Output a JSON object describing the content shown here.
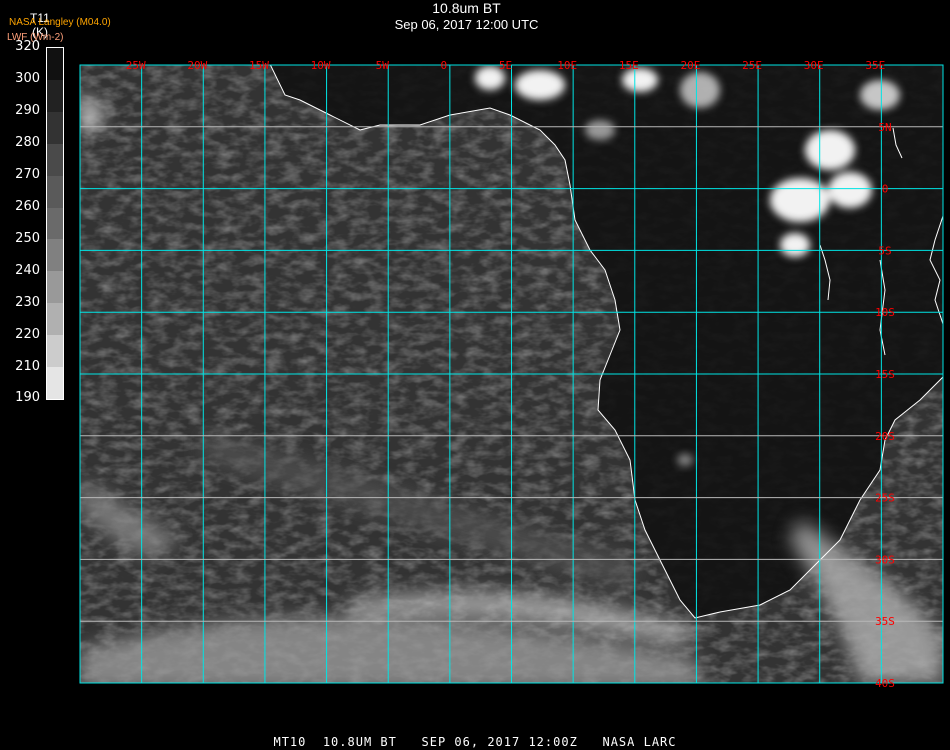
{
  "header": {
    "title": "10.8um BT",
    "subtitle": "Sep 06, 2017 12:00 UTC"
  },
  "colorbar": {
    "variable": "T11",
    "unit": "(K)",
    "org_label": "NASA Langley (M04.0)",
    "product_label": "LWF (Wm-2)",
    "labels": [
      "320",
      "300",
      "290",
      "280",
      "270",
      "260",
      "250",
      "240",
      "230",
      "220",
      "210",
      "190"
    ],
    "segment_colors": [
      "#111111",
      "#222222",
      "#333333",
      "#4a4a4a",
      "#5a5a5a",
      "#6a6a6a",
      "#808080",
      "#999999",
      "#b0b0b0",
      "#cccccc",
      "#e5e5e5",
      "#ffffff"
    ]
  },
  "map": {
    "lon_range": [
      -30,
      40
    ],
    "lat_range": [
      -40,
      10
    ],
    "grid_color": "#00e5e5",
    "label_color": "#ff0000",
    "coast_color": "#ffffff",
    "lon_labels": [
      {
        "lon": -25,
        "text": "25W"
      },
      {
        "lon": -20,
        "text": "20W"
      },
      {
        "lon": -15,
        "text": "15W"
      },
      {
        "lon": -10,
        "text": "10W"
      },
      {
        "lon": -5,
        "text": "5W"
      },
      {
        "lon": 0,
        "text": "0"
      },
      {
        "lon": 5,
        "text": "5E"
      },
      {
        "lon": 10,
        "text": "10E"
      },
      {
        "lon": 15,
        "text": "15E"
      },
      {
        "lon": 20,
        "text": "20E"
      },
      {
        "lon": 25,
        "text": "25E"
      },
      {
        "lon": 30,
        "text": "30E"
      },
      {
        "lon": 35,
        "text": "35E"
      }
    ],
    "lat_labels": [
      {
        "lat": 5,
        "text": "5N"
      },
      {
        "lat": 0,
        "text": "0"
      },
      {
        "lat": -5,
        "text": "5S"
      },
      {
        "lat": -10,
        "text": "10S"
      },
      {
        "lat": -15,
        "text": "15S"
      },
      {
        "lat": -20,
        "text": "20S"
      },
      {
        "lat": -25,
        "text": "25S"
      },
      {
        "lat": -30,
        "text": "30S"
      },
      {
        "lat": -35,
        "text": "35S"
      },
      {
        "lat": -40,
        "text": "40S"
      }
    ]
  },
  "footer": {
    "text": "MT10  10.8UM BT   SEP 06, 2017 12:00Z   NASA LARC"
  }
}
